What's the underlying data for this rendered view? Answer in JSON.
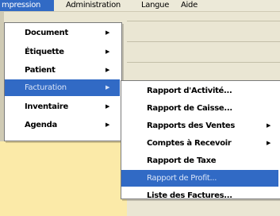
{
  "menubar": {
    "items": [
      {
        "label": "mpression",
        "active": true
      },
      {
        "label": "Administration",
        "active": false
      },
      {
        "label": "Langue",
        "active": false
      },
      {
        "label": "Aide",
        "active": false
      }
    ]
  },
  "impression_menu": {
    "items": [
      {
        "label": "Document",
        "submenu": true
      },
      {
        "label": "Étiquette",
        "submenu": true
      },
      {
        "label": "Patient",
        "submenu": true
      },
      {
        "label": "Facturation",
        "submenu": true,
        "highlighted": true
      },
      {
        "label": "Inventaire",
        "submenu": true
      },
      {
        "label": "Agenda",
        "submenu": true
      }
    ]
  },
  "facturation_menu": {
    "items": [
      {
        "label": "Rapport d'Activité...",
        "submenu": false
      },
      {
        "label": "Rapport de Caisse...",
        "submenu": false
      },
      {
        "label": "Rapports des Ventes",
        "submenu": true
      },
      {
        "label": "Comptes à Recevoir",
        "submenu": true
      },
      {
        "label": "Rapport de Taxe",
        "submenu": false
      },
      {
        "label": "Rapport de Profit...",
        "submenu": false,
        "highlighted": true
      },
      {
        "label": "Liste des Factures...",
        "submenu": false
      }
    ]
  },
  "icons": {
    "submenu_arrow": "triangle-right-icon"
  },
  "colors": {
    "highlight": "#316ac5",
    "panel_yellow": "#fbeaa8",
    "menubar": "#ece9d8"
  }
}
